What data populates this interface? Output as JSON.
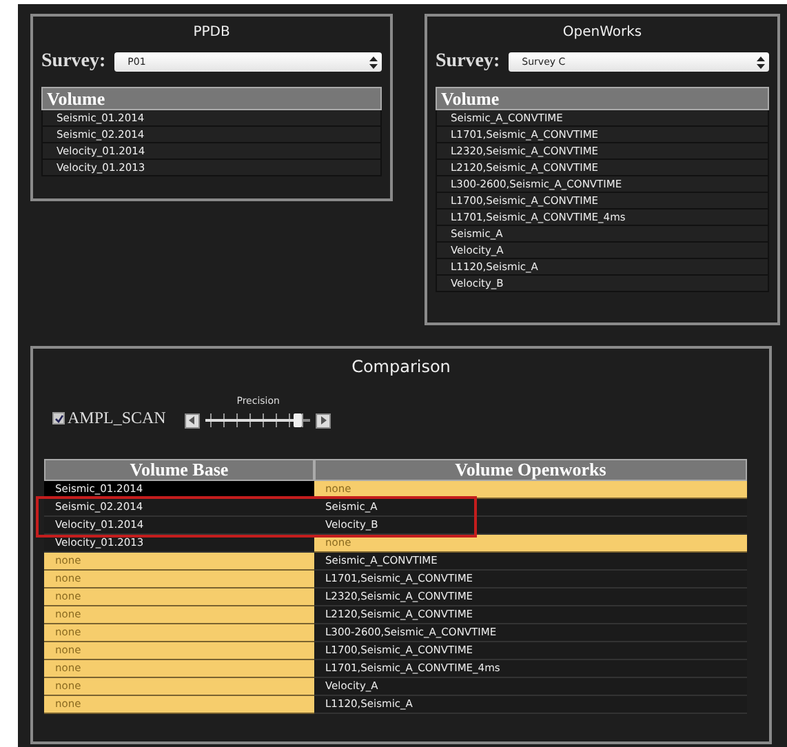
{
  "panels": [
    {
      "title": "PPDB",
      "survey_label": "Survey:",
      "survey_value": "P01",
      "list_header": "Volume",
      "items": [
        "Seismic_01.2014",
        "Seismic_02.2014",
        "Velocity_01.2014",
        "Velocity_01.2013"
      ]
    },
    {
      "title": "OpenWorks",
      "survey_label": "Survey:",
      "survey_value": "Survey C",
      "list_header": "Volume",
      "items": [
        "Seismic_A_CONVTIME",
        "L1701,Seismic_A_CONVTIME",
        "L2320,Seismic_A_CONVTIME",
        "L2120,Seismic_A_CONVTIME",
        "L300-2600,Seismic_A_CONVTIME",
        "L1700,Seismic_A_CONVTIME",
        "L1701,Seismic_A_CONVTIME_4ms",
        "Seismic_A",
        "Velocity_A",
        "L1120,Seismic_A",
        "Velocity_B"
      ]
    }
  ],
  "comparison": {
    "title": "Comparison",
    "ampl_scan": {
      "label": "AMPL_SCAN",
      "checked": true
    },
    "precision": {
      "label": "Precision",
      "level": 0.88
    },
    "columns": [
      "Volume Base",
      "Volume Openworks"
    ],
    "rows": [
      {
        "base": {
          "text": "Seismic_01.2014",
          "missing": false
        },
        "openworks": {
          "text": "none",
          "missing": true
        },
        "selected": true,
        "highlighted": false
      },
      {
        "base": {
          "text": "Seismic_02.2014",
          "missing": false
        },
        "openworks": {
          "text": "Seismic_A",
          "missing": false
        },
        "selected": false,
        "highlighted": true
      },
      {
        "base": {
          "text": "Velocity_01.2014",
          "missing": false
        },
        "openworks": {
          "text": "Velocity_B",
          "missing": false
        },
        "selected": false,
        "highlighted": true
      },
      {
        "base": {
          "text": "Velocity_01.2013",
          "missing": false
        },
        "openworks": {
          "text": "none",
          "missing": true
        },
        "selected": false,
        "highlighted": false
      },
      {
        "base": {
          "text": "none",
          "missing": true
        },
        "openworks": {
          "text": "Seismic_A_CONVTIME",
          "missing": false
        },
        "selected": false,
        "highlighted": false
      },
      {
        "base": {
          "text": "none",
          "missing": true
        },
        "openworks": {
          "text": "L1701,Seismic_A_CONVTIME",
          "missing": false
        },
        "selected": false,
        "highlighted": false
      },
      {
        "base": {
          "text": "none",
          "missing": true
        },
        "openworks": {
          "text": "L2320,Seismic_A_CONVTIME",
          "missing": false
        },
        "selected": false,
        "highlighted": false
      },
      {
        "base": {
          "text": "none",
          "missing": true
        },
        "openworks": {
          "text": "L2120,Seismic_A_CONVTIME",
          "missing": false
        },
        "selected": false,
        "highlighted": false
      },
      {
        "base": {
          "text": "none",
          "missing": true
        },
        "openworks": {
          "text": "L300-2600,Seismic_A_CONVTIME",
          "missing": false
        },
        "selected": false,
        "highlighted": false
      },
      {
        "base": {
          "text": "none",
          "missing": true
        },
        "openworks": {
          "text": "L1700,Seismic_A_CONVTIME",
          "missing": false
        },
        "selected": false,
        "highlighted": false
      },
      {
        "base": {
          "text": "none",
          "missing": true
        },
        "openworks": {
          "text": "L1701,Seismic_A_CONVTIME_4ms",
          "missing": false
        },
        "selected": false,
        "highlighted": false
      },
      {
        "base": {
          "text": "none",
          "missing": true
        },
        "openworks": {
          "text": "Velocity_A",
          "missing": false
        },
        "selected": false,
        "highlighted": false
      },
      {
        "base": {
          "text": "none",
          "missing": true
        },
        "openworks": {
          "text": "L1120,Seismic_A",
          "missing": false
        },
        "selected": false,
        "highlighted": false
      }
    ]
  }
}
